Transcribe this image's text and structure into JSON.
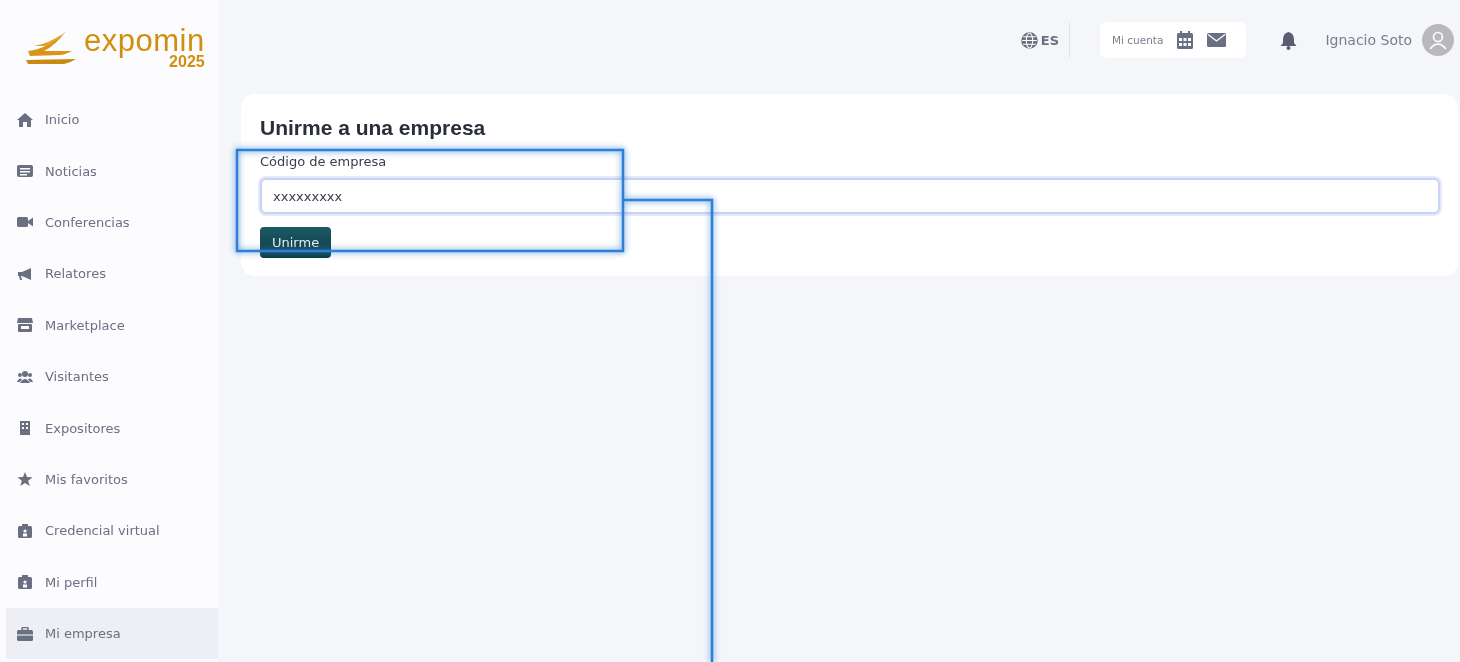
{
  "logo": {
    "name": "expomin",
    "year": "2025"
  },
  "sidebar": {
    "items": [
      {
        "label": "Inicio",
        "selected": false
      },
      {
        "label": "Noticias",
        "selected": false
      },
      {
        "label": "Conferencias",
        "selected": false
      },
      {
        "label": "Relatores",
        "selected": false
      },
      {
        "label": "Marketplace",
        "selected": false
      },
      {
        "label": "Visitantes",
        "selected": false
      },
      {
        "label": "Expositores",
        "selected": false
      },
      {
        "label": "Mis favoritos",
        "selected": false
      },
      {
        "label": "Credencial virtual",
        "selected": false
      },
      {
        "label": "Mi perfil",
        "selected": false
      },
      {
        "label": "Mi empresa",
        "selected": true
      }
    ]
  },
  "header": {
    "language": "ES",
    "account_label": "Mi cuenta",
    "user_name": "Ignacio Soto"
  },
  "card": {
    "title": "Unirme a una empresa",
    "field_label": "Código de empresa",
    "field_value": "xxxxxxxxx",
    "button": "Unirme"
  }
}
